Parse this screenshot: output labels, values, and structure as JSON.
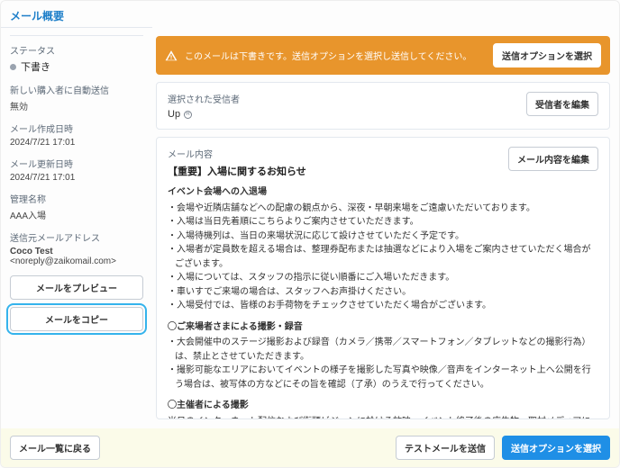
{
  "page": {
    "title": "メール概要"
  },
  "status": {
    "label": "ステータス",
    "value": "下書き"
  },
  "autoSend": {
    "label": "新しい購入者に自動送信",
    "value": "無効"
  },
  "createdAt": {
    "label": "メール作成日時",
    "value": "2024/7/21 17:01"
  },
  "updatedAt": {
    "label": "メール更新日時",
    "value": "2024/7/21 17:01"
  },
  "adminName": {
    "label": "管理名称",
    "value": "AAA入場"
  },
  "sender": {
    "label": "送信元メールアドレス",
    "name": "Coco Test",
    "addr": "<noreply@zaikomail.com>"
  },
  "sidebarButtons": {
    "preview": "メールをプレビュー",
    "copy": "メールをコピー"
  },
  "alert": {
    "msg": "このメールは下書きです。送信オプションを選択し送信してください。",
    "cta": "送信オプションを選択"
  },
  "recipients": {
    "label": "選択された受信者",
    "value": "Up",
    "editBtn": "受信者を編集"
  },
  "content": {
    "label": "メール内容",
    "editBtn": "メール内容を編集",
    "subject": "【重要】入場に関するお知らせ",
    "sec1": {
      "heading": "イベント会場への入退場",
      "bullets": [
        "・会場や近隣店舗などへの配慮の観点から、深夜・早朝来場をご遠慮いただいております。",
        "・入場は当日先着順にこちらよりご案内させていただきます。",
        "・入場待機列は、当日の来場状況に応じて設けさせていただく予定です。",
        "・入場者が定員数を超える場合は、整理券配布または抽選などにより入場をご案内させていただく場合がございます。",
        "・入場については、スタッフの指示に従い順番にご入場いただきます。",
        "・車いすでご来場の場合は、スタッフへお声掛けください。",
        "・入場受付では、皆様のお手荷物をチェックさせていただく場合がございます。"
      ]
    },
    "sec2": {
      "heading": "◯ご来場者さまによる撮影・録音",
      "bullets": [
        "・大会開催中のステージ撮影および録音（カメラ／携帯／スマートフォン／タブレットなどの撮影行為）は、禁止とさせていただきます。",
        "・撮影可能なエリアにおいてイベントの様子を撮影した写真や映像／音声をインターネット上へ公開を行う場合は、被写体の方などにその旨を確認（了承）のうえで行ってください。"
      ]
    },
    "sec3": {
      "heading": "◯主催者による撮影",
      "bullets": [
        "当日のインターネット配信および街頭ビジョンに於ける放映、イベント終了後の広告物、取材メディアによるテレビ／新聞／雑誌／WEBなどに露出／掲載される場合がありますので、あらかじめご了承ください。"
      ]
    }
  },
  "footer": {
    "back": "メール一覧に戻る",
    "test": "テストメールを送信",
    "send": "送信オプションを選択"
  }
}
